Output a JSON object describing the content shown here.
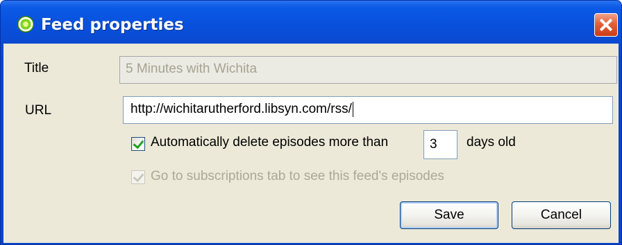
{
  "window": {
    "title": "Feed properties",
    "app_icon": "miro-globe-icon",
    "close_icon": "close-icon"
  },
  "form": {
    "title_label": "Title",
    "title_value": "5 Minutes with Wichita",
    "title_disabled": true,
    "url_label": "URL",
    "url_value": "http://wichitarutherford.libsyn.com/rss/",
    "auto_delete": {
      "checked": true,
      "label": "Automatically delete episodes more than",
      "days_value": "3",
      "suffix": "days old"
    },
    "goto_subscriptions": {
      "checked": true,
      "disabled": true,
      "label": "Go to subscriptions tab to see this feed's episodes"
    }
  },
  "buttons": {
    "save_label": "Save",
    "cancel_label": "Cancel"
  },
  "colors": {
    "titlebar": "#0a4bd3",
    "dialog_bg": "#ece9d8",
    "check_green": "#21a121",
    "disabled_text": "#aca899"
  }
}
